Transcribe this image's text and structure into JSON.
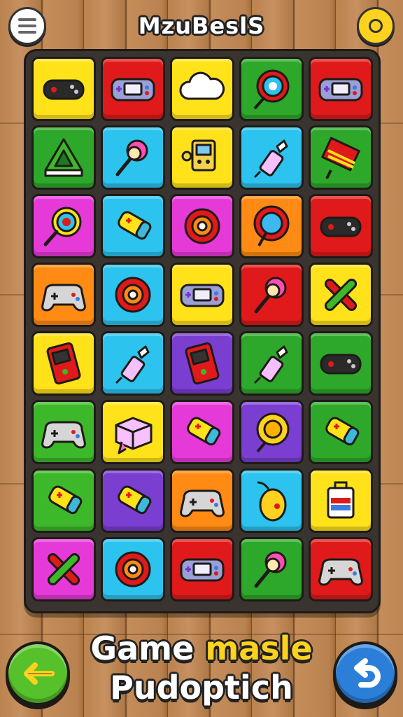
{
  "header": {
    "title": "MzuBeslS"
  },
  "footer": {
    "title_word1": "Game",
    "title_word2": "masle",
    "subtitle": "Pudoptich"
  },
  "colors": {
    "yellow": "#ffe21a",
    "red": "#e01a1a",
    "green": "#2ea82a",
    "cyan": "#2cc3ee",
    "magenta": "#e63ad8",
    "orange": "#ff8a14",
    "purple": "#7a3ed0",
    "lime": "#3db82a"
  },
  "board": {
    "rows": [
      [
        {
          "color": "yellow",
          "icon": "controller-icon"
        },
        {
          "color": "red",
          "icon": "handheld-console-icon"
        },
        {
          "color": "yellow",
          "icon": "cloud-icon"
        },
        {
          "color": "green",
          "icon": "lollipop-flower-icon"
        },
        {
          "color": "red",
          "icon": "handheld-console-icon"
        }
      ],
      [
        {
          "color": "green",
          "icon": "triangle-icon"
        },
        {
          "color": "cyan",
          "icon": "pompom-wand-icon"
        },
        {
          "color": "yellow",
          "icon": "robot-icon"
        },
        {
          "color": "cyan",
          "icon": "glue-bottle-icon"
        },
        {
          "color": "green",
          "icon": "striped-bar-icon"
        }
      ],
      [
        {
          "color": "magenta",
          "icon": "lollipop-swirl-icon"
        },
        {
          "color": "cyan",
          "icon": "battery-icon"
        },
        {
          "color": "magenta",
          "icon": "gear-flower-icon"
        },
        {
          "color": "orange",
          "icon": "balloon-flower-icon"
        },
        {
          "color": "red",
          "icon": "controller-icon"
        }
      ],
      [
        {
          "color": "orange",
          "icon": "gamepad-icon"
        },
        {
          "color": "cyan",
          "icon": "gear-flower-icon"
        },
        {
          "color": "yellow",
          "icon": "handheld-console-icon"
        },
        {
          "color": "red",
          "icon": "pompom-wand-icon"
        },
        {
          "color": "yellow",
          "icon": "crossed-sticks-icon"
        }
      ],
      [
        {
          "color": "yellow",
          "icon": "handheld-device-icon"
        },
        {
          "color": "cyan",
          "icon": "glue-bottle-icon"
        },
        {
          "color": "purple",
          "icon": "handheld-device-icon"
        },
        {
          "color": "green",
          "icon": "glue-bottle-icon"
        },
        {
          "color": "green",
          "icon": "controller-icon"
        }
      ],
      [
        {
          "color": "lime",
          "icon": "gamepad-icon"
        },
        {
          "color": "yellow",
          "icon": "box-icon"
        },
        {
          "color": "magenta",
          "icon": "battery-icon"
        },
        {
          "color": "purple",
          "icon": "sunflower-icon"
        },
        {
          "color": "green",
          "icon": "battery-icon"
        }
      ],
      [
        {
          "color": "lime",
          "icon": "battery-icon"
        },
        {
          "color": "purple",
          "icon": "battery-icon"
        },
        {
          "color": "orange",
          "icon": "gamepad-icon"
        },
        {
          "color": "cyan",
          "icon": "mouse-icon"
        },
        {
          "color": "yellow",
          "icon": "lunchbox-icon"
        }
      ],
      [
        {
          "color": "magenta",
          "icon": "crossed-sticks-icon"
        },
        {
          "color": "cyan",
          "icon": "gear-flower-icon"
        },
        {
          "color": "red",
          "icon": "handheld-console-icon"
        },
        {
          "color": "green",
          "icon": "pompom-wand-icon"
        },
        {
          "color": "red",
          "icon": "gamepad-icon"
        }
      ]
    ]
  },
  "buttons": {
    "menu_icon": "hamburger-menu-icon",
    "coin_icon": "coin-icon",
    "back_icon": "back-arrow-icon",
    "undo_icon": "undo-arrow-icon"
  }
}
